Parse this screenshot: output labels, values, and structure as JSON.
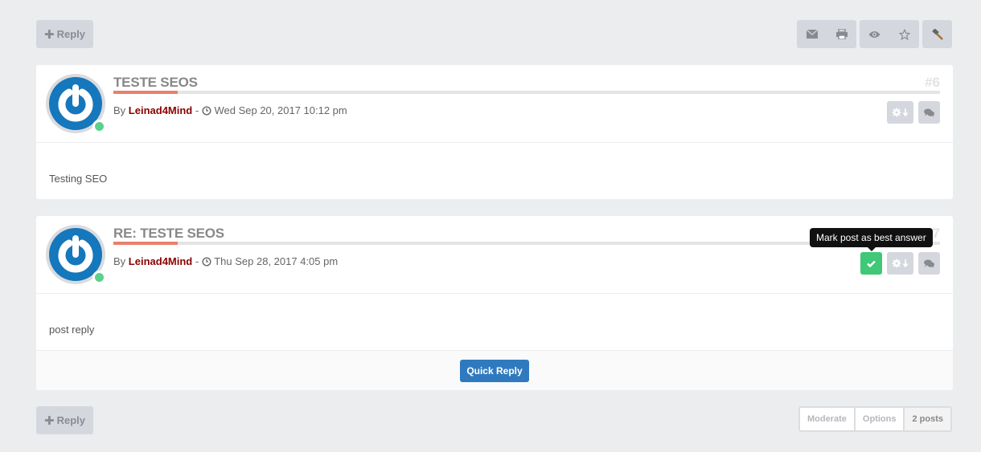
{
  "toolbar": {
    "reply_label": "Reply",
    "tools": [
      {
        "icon": "envelope-icon",
        "label": "Email topic"
      },
      {
        "icon": "print-icon",
        "label": "Print view"
      },
      {
        "icon": "eye-icon",
        "label": "Watch topic"
      },
      {
        "icon": "star-icon",
        "label": "Bookmark topic"
      },
      {
        "icon": "hammer-icon",
        "label": "Moderator tools"
      }
    ]
  },
  "posts": [
    {
      "title": "TESTE SEOS",
      "number": "#6",
      "by_label": "By",
      "author": "Leinad4Mind",
      "separator": "-",
      "date": "Wed Sep 20, 2017 10:12 pm",
      "content": "Testing SEO",
      "online": true
    },
    {
      "title": "RE: TESTE SEOS",
      "number": "#7",
      "by_label": "By",
      "author": "Leinad4Mind",
      "separator": "-",
      "date": "Thu Sep 28, 2017 4:05 pm",
      "content": "post reply",
      "online": true
    }
  ],
  "tooltip": "Mark post as best answer",
  "quick_reply_label": "Quick Reply",
  "pagination": {
    "moderate": "Moderate",
    "options": "Options",
    "count": "2 posts"
  },
  "colors": {
    "accent": "#e8806c",
    "author": "#8b0000",
    "best_answer": "#3ec878",
    "quick_reply": "#2f7abf",
    "online": "#5dd08c"
  }
}
